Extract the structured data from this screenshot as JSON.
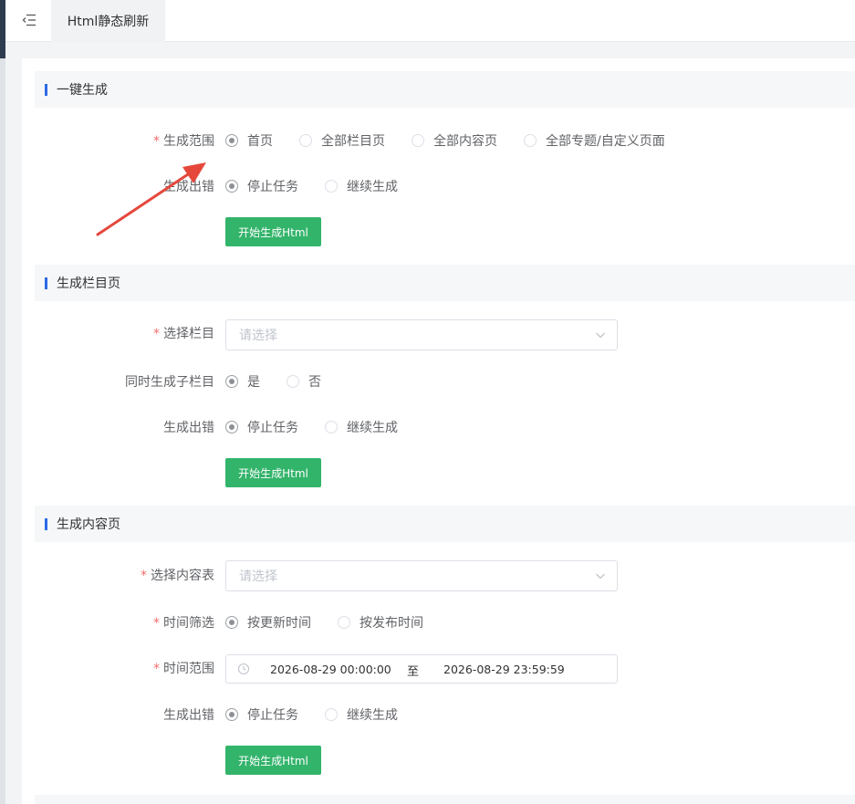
{
  "tab": {
    "title": "Html静态刷新"
  },
  "sections": {
    "one_click": {
      "title": "一键生成",
      "scope_label": "生成范围",
      "scope_options": [
        "首页",
        "全部栏目页",
        "全部内容页",
        "全部专题/自定义页面"
      ],
      "scope_selected": "首页",
      "error_label": "生成出错",
      "error_options": [
        "停止任务",
        "继续生成"
      ],
      "error_selected": "停止任务",
      "button": "开始生成Html"
    },
    "category": {
      "title": "生成栏目页",
      "select_label": "选择栏目",
      "select_placeholder": "请选择",
      "children_label": "同时生成子栏目",
      "children_options": [
        "是",
        "否"
      ],
      "children_selected": "是",
      "error_label": "生成出错",
      "error_options": [
        "停止任务",
        "继续生成"
      ],
      "error_selected": "停止任务",
      "button": "开始生成Html"
    },
    "content": {
      "title": "生成内容页",
      "table_label": "选择内容表",
      "table_placeholder": "请选择",
      "time_filter_label": "时间筛选",
      "time_filter_options": [
        "按更新时间",
        "按发布时间"
      ],
      "time_filter_selected": "按更新时间",
      "time_range_label": "时间范围",
      "time_range_start": "2026-08-29 00:00:00",
      "time_range_sep": "至",
      "time_range_end": "2026-08-29 23:59:59",
      "error_label": "生成出错",
      "error_options": [
        "停止任务",
        "继续生成"
      ],
      "error_selected": "停止任务",
      "button": "开始生成Html"
    }
  },
  "colors": {
    "accent_green": "#33b46b",
    "section_bar": "#2d6be4",
    "required_star": "#f56c6c",
    "annotation_arrow": "#e5483b"
  },
  "icons": {
    "menu_toggle": "menu-fold-icon",
    "select_arrow": "chevron-down-icon",
    "time": "clock-icon"
  }
}
